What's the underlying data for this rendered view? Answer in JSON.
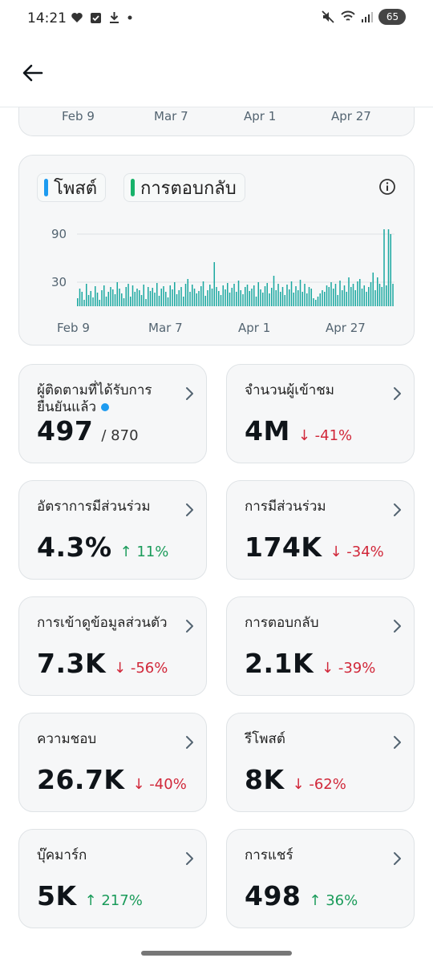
{
  "status_bar": {
    "time": "14:21",
    "battery": "65"
  },
  "top_axis": {
    "labels": [
      "Feb 9",
      "Mar 7",
      "Apr 1",
      "Apr 27"
    ]
  },
  "chart_card": {
    "legend": [
      {
        "label": "โพสต์",
        "color": "#1d9bf0"
      },
      {
        "label": "การตอบกลับ",
        "color": "#17b26a"
      }
    ],
    "chart_data": {
      "type": "bar",
      "series": [
        {
          "name": "โพสต์",
          "color": "#1d9bf0"
        },
        {
          "name": "การตอบกลับ",
          "color": "#17b26a"
        }
      ],
      "ylim": [
        0,
        100
      ],
      "y_ticks": [
        30,
        90
      ],
      "x_tick_labels": [
        "Feb 9",
        "Mar 7",
        "Apr 1",
        "Apr 27"
      ],
      "grid": true,
      "values": [
        10,
        22,
        18,
        8,
        28,
        14,
        19,
        11,
        25,
        17,
        8,
        20,
        26,
        12,
        18,
        24,
        21,
        15,
        30,
        22,
        16,
        10,
        24,
        28,
        12,
        26,
        18,
        22,
        20,
        14,
        27,
        9,
        24,
        19,
        23,
        17,
        29,
        13,
        22,
        25,
        18,
        11,
        26,
        21,
        30,
        15,
        20,
        24,
        12,
        28,
        34,
        18,
        27,
        22,
        16,
        19,
        25,
        31,
        13,
        20,
        27,
        22,
        55,
        24,
        19,
        14,
        26,
        21,
        29,
        17,
        23,
        28,
        18,
        32,
        20,
        15,
        24,
        27,
        19,
        22,
        26,
        12,
        30,
        21,
        17,
        25,
        29,
        16,
        23,
        38,
        20,
        28,
        18,
        24,
        14,
        27,
        21,
        31,
        17,
        25,
        20,
        33,
        18,
        28,
        16,
        24,
        22,
        10,
        8,
        12,
        16,
        20,
        18,
        26,
        24,
        30,
        22,
        28,
        14,
        32,
        20,
        26,
        18,
        36,
        24,
        28,
        20,
        31,
        34,
        22,
        26,
        18,
        24,
        30,
        42,
        20,
        36,
        28,
        24,
        96,
        26,
        96,
        90,
        28
      ]
    }
  },
  "metrics": [
    {
      "title": "ผู้ติดตามที่ได้รับการยืนยันแล้ว",
      "value": "497",
      "sub": "/ 870",
      "change": "",
      "direction": "none",
      "verified": true
    },
    {
      "title": "จำนวนผู้เข้าชม",
      "value": "4M",
      "change": "↓ -41%",
      "direction": "down"
    },
    {
      "title": "อัตราการมีส่วนร่วม",
      "value": "4.3%",
      "change": "↑ 11%",
      "direction": "up"
    },
    {
      "title": "การมีส่วนร่วม",
      "value": "174K",
      "change": "↓ -34%",
      "direction": "down"
    },
    {
      "title": "การเข้าดูข้อมูลส่วนตัว",
      "value": "7.3K",
      "change": "↓ -56%",
      "direction": "down"
    },
    {
      "title": "การตอบกลับ",
      "value": "2.1K",
      "change": "↓ -39%",
      "direction": "down"
    },
    {
      "title": "ความชอบ",
      "value": "26.7K",
      "change": "↓ -40%",
      "direction": "down"
    },
    {
      "title": "รีโพสต์",
      "value": "8K",
      "change": "↓ -62%",
      "direction": "down"
    },
    {
      "title": "บุ๊คมาร์ก",
      "value": "5K",
      "change": "↑ 217%",
      "direction": "up"
    },
    {
      "title": "การแชร์",
      "value": "498",
      "change": "↑ 36%",
      "direction": "up"
    }
  ]
}
